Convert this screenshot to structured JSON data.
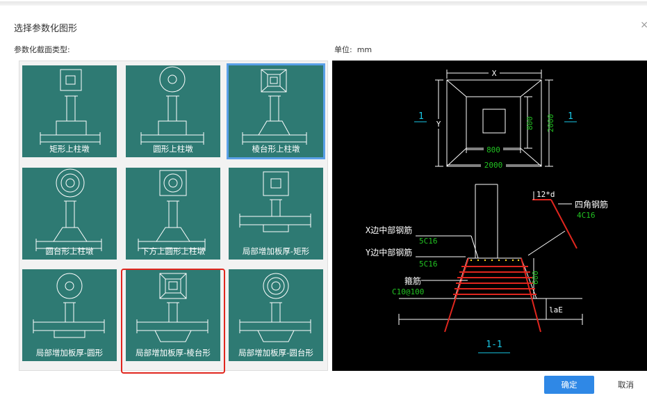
{
  "dialog": {
    "title": "选择参数化图形",
    "close": "×"
  },
  "left_label": "参数化截面类型:",
  "unit_label": "单位:",
  "unit_value": "mm",
  "shapes": [
    {
      "label": "矩形上柱墩"
    },
    {
      "label": "圆形上柱墩"
    },
    {
      "label": "棱台形上柱墩"
    },
    {
      "label": "圆台形上柱墩"
    },
    {
      "label": "下方上圆形上柱墩"
    },
    {
      "label": "局部增加板厚-矩形"
    },
    {
      "label": "局部增加板厚-圆形"
    },
    {
      "label": "局部增加板厚-棱台形"
    },
    {
      "label": "局部增加板厚-圆台形"
    }
  ],
  "preview": {
    "dim_x": "X",
    "dim_y": "Y",
    "dim_800_v": "800",
    "dim_2000_v": "2000",
    "dim_800_h": "800",
    "dim_2000_h": "2000",
    "section_mark_left": "1",
    "section_mark_right": "1",
    "lap": "12*d",
    "corner_rebar": "四角钢筋",
    "corner_rebar_spec": "4C16",
    "x_mid_rebar": "X边中部钢筋",
    "x_mid_spec": "5C16",
    "y_mid_rebar": "Y边中部钢筋",
    "y_mid_spec": "5C16",
    "stirrup": "箍筋",
    "stirrup_spec": "C10@100",
    "height_600": "600",
    "lae": "laE",
    "section_title": "1-1"
  },
  "buttons": {
    "ok": "确定",
    "cancel": "取消"
  },
  "colors": {
    "tile": "#2e7a73",
    "accent": "#2f88e6",
    "highlight_red": "#e0261e",
    "dim_green": "#22c322",
    "cyan": "#19c8e6"
  }
}
